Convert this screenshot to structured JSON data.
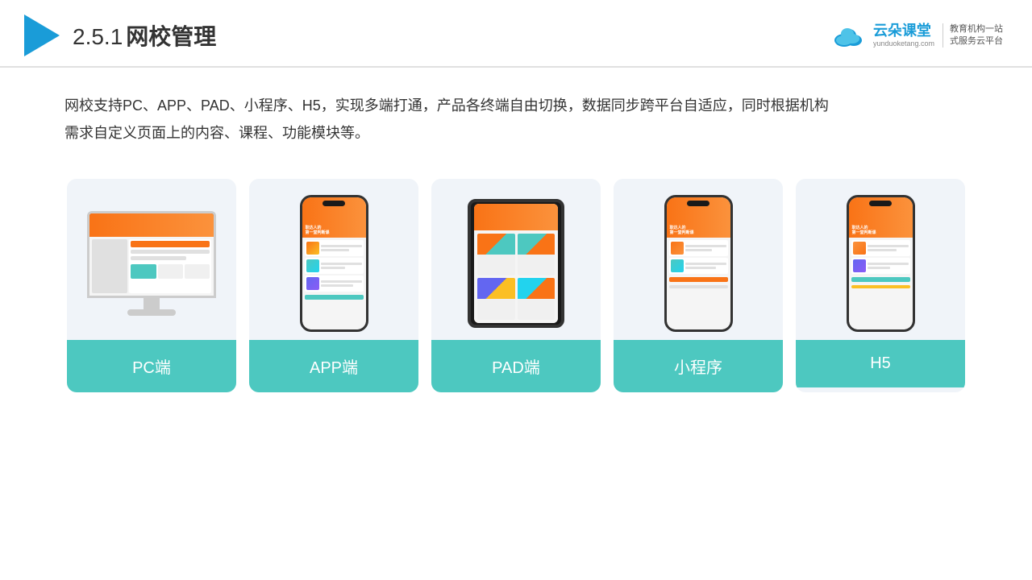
{
  "header": {
    "title_number": "2.5.1",
    "title_text": "网校管理",
    "brand": {
      "name": "云朵课堂",
      "url": "yunduoketang.com",
      "slogan": "教育机构一站\n式服务云平台"
    }
  },
  "description": {
    "text": "网校支持PC、APP、PAD、小程序、H5，实现多端打通，产品各终端自由切换，数据同步跨平台自适应，同时根据机构\n需求自定义页面上的内容、课程、功能模块等。"
  },
  "devices": [
    {
      "id": "pc",
      "label": "PC端",
      "type": "pc"
    },
    {
      "id": "app",
      "label": "APP端",
      "type": "phone"
    },
    {
      "id": "pad",
      "label": "PAD端",
      "type": "tablet"
    },
    {
      "id": "miniprogram",
      "label": "小程序",
      "type": "phone"
    },
    {
      "id": "h5",
      "label": "H5",
      "type": "phone"
    }
  ]
}
